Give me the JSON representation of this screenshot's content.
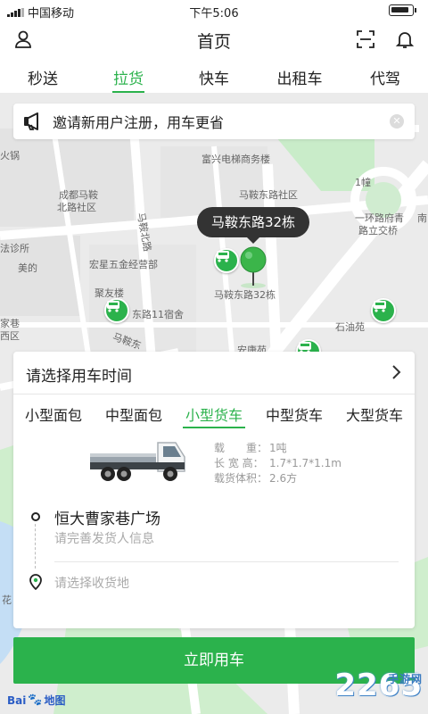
{
  "status_bar": {
    "carrier": "中国移动",
    "time": "下午5:06"
  },
  "header": {
    "title": "首页"
  },
  "tabs": [
    {
      "label": "秒送"
    },
    {
      "label": "拉货",
      "active": true
    },
    {
      "label": "快车"
    },
    {
      "label": "出租车"
    },
    {
      "label": "代驾"
    }
  ],
  "invite": {
    "text": "邀请新用户注册，用车更省"
  },
  "map": {
    "pin_callout": "马鞍东路32栋",
    "labels": {
      "l1": "火锅",
      "l2": "富兴电梯商务楼",
      "l3": "成都马鞍",
      "l4": "北路社区",
      "l5": "马鞍东路社区",
      "l6": "1幢",
      "l7": "一环路府青",
      "l8": "路立交桥",
      "l9": "南",
      "l10": "法诊所",
      "l11": "美的",
      "l12": "宏星五金经营部",
      "l13": "聚友楼",
      "l14": "马鞍东路32栋",
      "l15": "东路11宿舍",
      "l16": "家巷",
      "l17": "西区",
      "l18": "石油苑",
      "l19": "安康苑",
      "l20": "马鞍东",
      "l21": "马鞍北路",
      "l22": "花"
    }
  },
  "card": {
    "time_prompt": "请选择用车时间",
    "vehicle_types": [
      {
        "label": "小型面包"
      },
      {
        "label": "中型面包"
      },
      {
        "label": "小型货车",
        "active": true
      },
      {
        "label": "中型货车"
      },
      {
        "label": "大型货车"
      }
    ],
    "specs": [
      {
        "key": "载　　重：",
        "value": "1吨"
      },
      {
        "key": "长 宽 高：",
        "value": "1.7*1.7*1.1m"
      },
      {
        "key": "载货体积：",
        "value": "2.6方"
      }
    ],
    "from_address": "恒大曹家巷广场",
    "from_sub": "请完善发货人信息",
    "to_placeholder": "请选择收货地"
  },
  "confirm_button": "立即用车",
  "map_logo": "地图",
  "watermark": {
    "number": "2265",
    "suffix": "手游网"
  },
  "colors": {
    "accent": "#2bb24c",
    "callout_bg": "#333333"
  }
}
